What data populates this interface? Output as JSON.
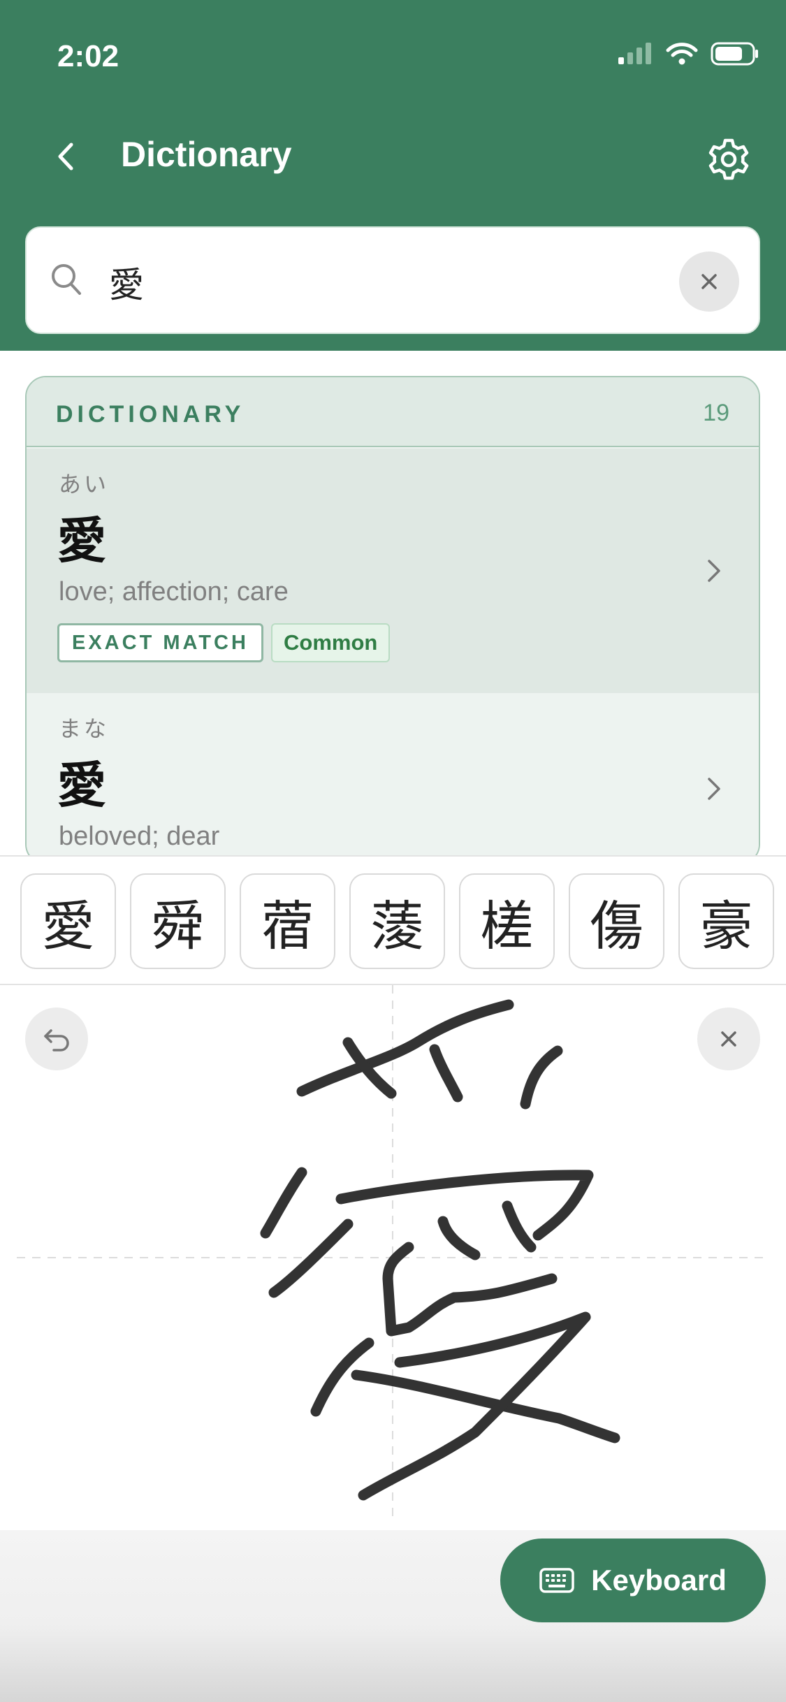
{
  "status_bar": {
    "time": "2:02"
  },
  "header": {
    "title": "Dictionary"
  },
  "search": {
    "value": "愛"
  },
  "results": {
    "section_title": "DICTIONARY",
    "count": "19",
    "entries": [
      {
        "reading": "あい",
        "kanji": "愛",
        "meaning": "love; affection; care",
        "badges": [
          "EXACT MATCH",
          "Common"
        ]
      },
      {
        "reading": "まな",
        "kanji": "愛",
        "meaning": "beloved; dear"
      }
    ]
  },
  "candidates": [
    "愛",
    "舜",
    "蓿",
    "蔆",
    "槎",
    "傷",
    "豪"
  ],
  "keyboard_button": {
    "label": "Keyboard"
  },
  "colors": {
    "accent": "#3b7f5f",
    "header_bg": "#3b7f5f",
    "panel_bg": "#dfeae4",
    "common_green": "#2f7d44"
  },
  "icons": {
    "back": "chevron-left-icon",
    "settings": "gear-icon",
    "search": "search-icon",
    "clear": "close-icon",
    "undo": "undo-icon",
    "clear_pad": "close-icon",
    "keyboard": "keyboard-icon"
  }
}
